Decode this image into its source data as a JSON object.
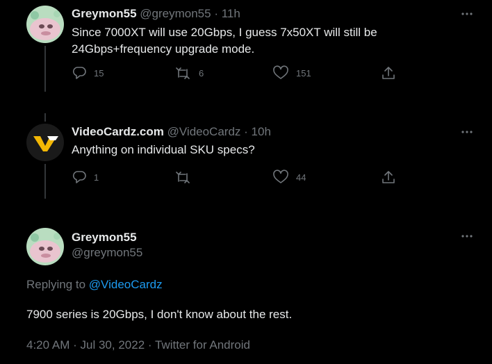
{
  "tweets": [
    {
      "name": "Greymon55",
      "handle": "@greymon55",
      "separator": "·",
      "time": "11h",
      "text_line1": "Since 7000XT will use 20Gbps, I guess 7x50XT will still be",
      "text_line2": "24Gbps+frequency upgrade mode.",
      "replies": "15",
      "retweets": "6",
      "likes": "151"
    },
    {
      "name": "VideoCardz.com",
      "handle": "@VideoCardz",
      "separator": "·",
      "time": "10h",
      "text": "Anything on individual SKU specs?",
      "replies": "1",
      "retweets": "",
      "likes": "44"
    }
  ],
  "main_tweet": {
    "name": "Greymon55",
    "handle": "@greymon55",
    "replying_prefix": "Replying to",
    "replying_to": "@VideoCardz",
    "text": "7900 series is 20Gbps, I don't know about the rest.",
    "timestamp": "4:20 AM",
    "separator": "·",
    "date": "Jul 30, 2022",
    "source": "Twitter for Android"
  },
  "colors": {
    "background": "#000000",
    "text": "#e7e9ea",
    "muted": "#71767b",
    "link": "#1d9bf0",
    "brand_yellow": "#f2b705"
  },
  "icons": [
    "reply-icon",
    "retweet-icon",
    "like-icon",
    "share-icon",
    "more-icon"
  ]
}
